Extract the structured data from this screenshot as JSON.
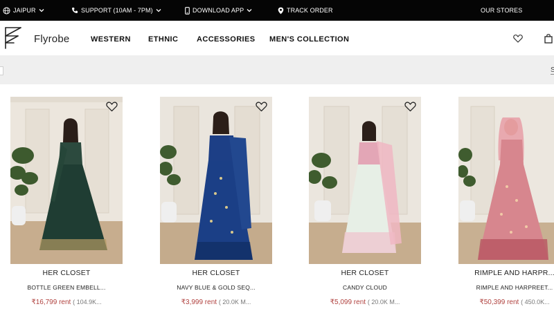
{
  "topbar": {
    "location": "JAIPUR",
    "support": "SUPPORT (10AM - 7PM)",
    "download": "DOWNLOAD APP",
    "track": "TRACK ORDER",
    "stores": "OUR STORES"
  },
  "header": {
    "brand": "Flyrobe",
    "nav": [
      "WESTERN",
      "ETHNIC",
      "ACCESSORIES",
      "MEN'S COLLECTION"
    ],
    "icons": [
      "heart-icon",
      "shopping-bag-icon"
    ]
  },
  "filterbar": {
    "right_label": "S"
  },
  "products": [
    {
      "brand": "HER CLOSET",
      "name": "BOTTLE GREEN EMBELL...",
      "price": "₹16,799 rent",
      "views": "( 104.9K...",
      "color": "#1f3d33"
    },
    {
      "brand": "HER CLOSET",
      "name": "NAVY BLUE & GOLD SEQ...",
      "price": "₹3,999 rent",
      "views": "( 20.0K M...",
      "color": "#1b3f86"
    },
    {
      "brand": "HER CLOSET",
      "name": "CANDY CLOUD",
      "price": "₹5,099 rent",
      "views": "( 20.0K M...",
      "color": "#e8cfd4"
    },
    {
      "brand": "RIMPLE AND HARPR...",
      "name": "RIMPLE AND HARPREET...",
      "price": "₹50,399 rent",
      "views": "( 450.0K...",
      "color": "#d7868e"
    }
  ],
  "colors": {
    "topbar": "#050505",
    "strip": "#efefef",
    "rent": "#b0413e"
  }
}
